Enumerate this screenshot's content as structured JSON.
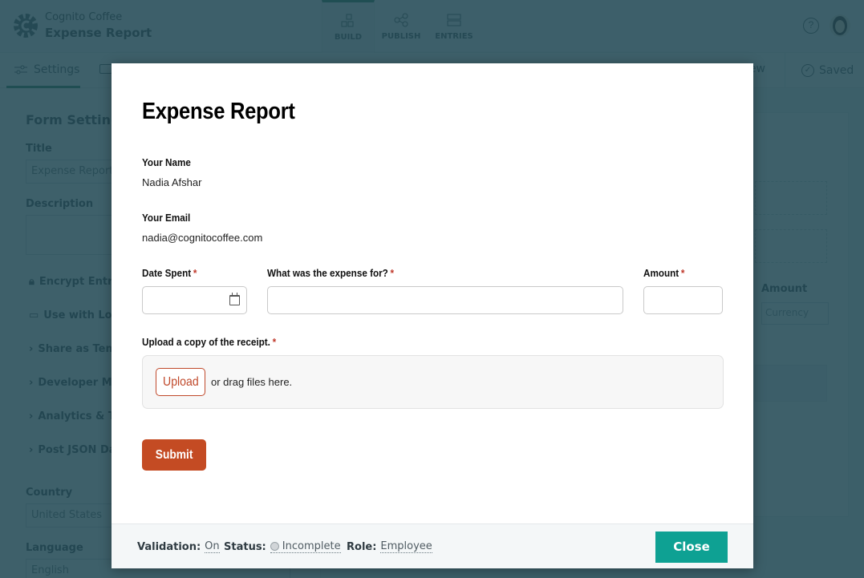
{
  "app": {
    "org_name": "Cognito Coffee",
    "form_name": "Expense Report",
    "nav_tabs": [
      {
        "label": "BUILD",
        "icon": "build-icon",
        "active": true
      },
      {
        "label": "PUBLISH",
        "icon": "share-icon",
        "active": false
      },
      {
        "label": "ENTRIES",
        "icon": "entries-icon",
        "active": false
      }
    ],
    "help_glyph": "?",
    "subbar": {
      "settings_label": "Settings",
      "preview_label": "iew",
      "saved_label": "Saved",
      "saved_glyph": "✓"
    },
    "settings_panel": {
      "heading": "Form Settings",
      "title_label": "Title",
      "title_value": "Expense Report",
      "description_label": "Description",
      "options": [
        {
          "label": "Encrypt Entry Data",
          "icon": "lock-icon"
        },
        {
          "label": "Use with Lookup",
          "icon": "lookup-icon"
        },
        {
          "label": "Share as Template",
          "icon": "chevron-right-icon"
        },
        {
          "label": "Developer Mode",
          "icon": "chevron-right-icon"
        },
        {
          "label": "Analytics & Tracking",
          "icon": "chevron-right-icon"
        },
        {
          "label": "Post JSON Data",
          "icon": "chevron-right-icon"
        }
      ],
      "country_label": "Country",
      "country_value": "United States",
      "language_label": "Language",
      "language_value": "English"
    },
    "canvas": {
      "amount_label": "Amount",
      "currency_placeholder": "Currency"
    }
  },
  "modal": {
    "title": "Expense Report",
    "fields": {
      "name_label": "Your Name",
      "name_value": "Nadia Afshar",
      "email_label": "Your Email",
      "email_value": "nadia@cognitocoffee.com",
      "date_label": "Date Spent",
      "expense_label": "What was the expense for?",
      "amount_label": "Amount",
      "upload_label": "Upload a copy of the receipt.",
      "required_mark": "*"
    },
    "upload_button": "Upload",
    "drag_text": "or drag files here.",
    "submit_label": "Submit",
    "footer": {
      "validation_label": "Validation:",
      "validation_value": "On",
      "status_label": "Status:",
      "status_value": "Incomplete",
      "role_label": "Role:",
      "role_value": "Employee",
      "close_label": "Close"
    }
  },
  "colors": {
    "overlay": "#1e4652",
    "submit": "#c44b23",
    "close": "#0ea193",
    "required": "#c0392b"
  }
}
